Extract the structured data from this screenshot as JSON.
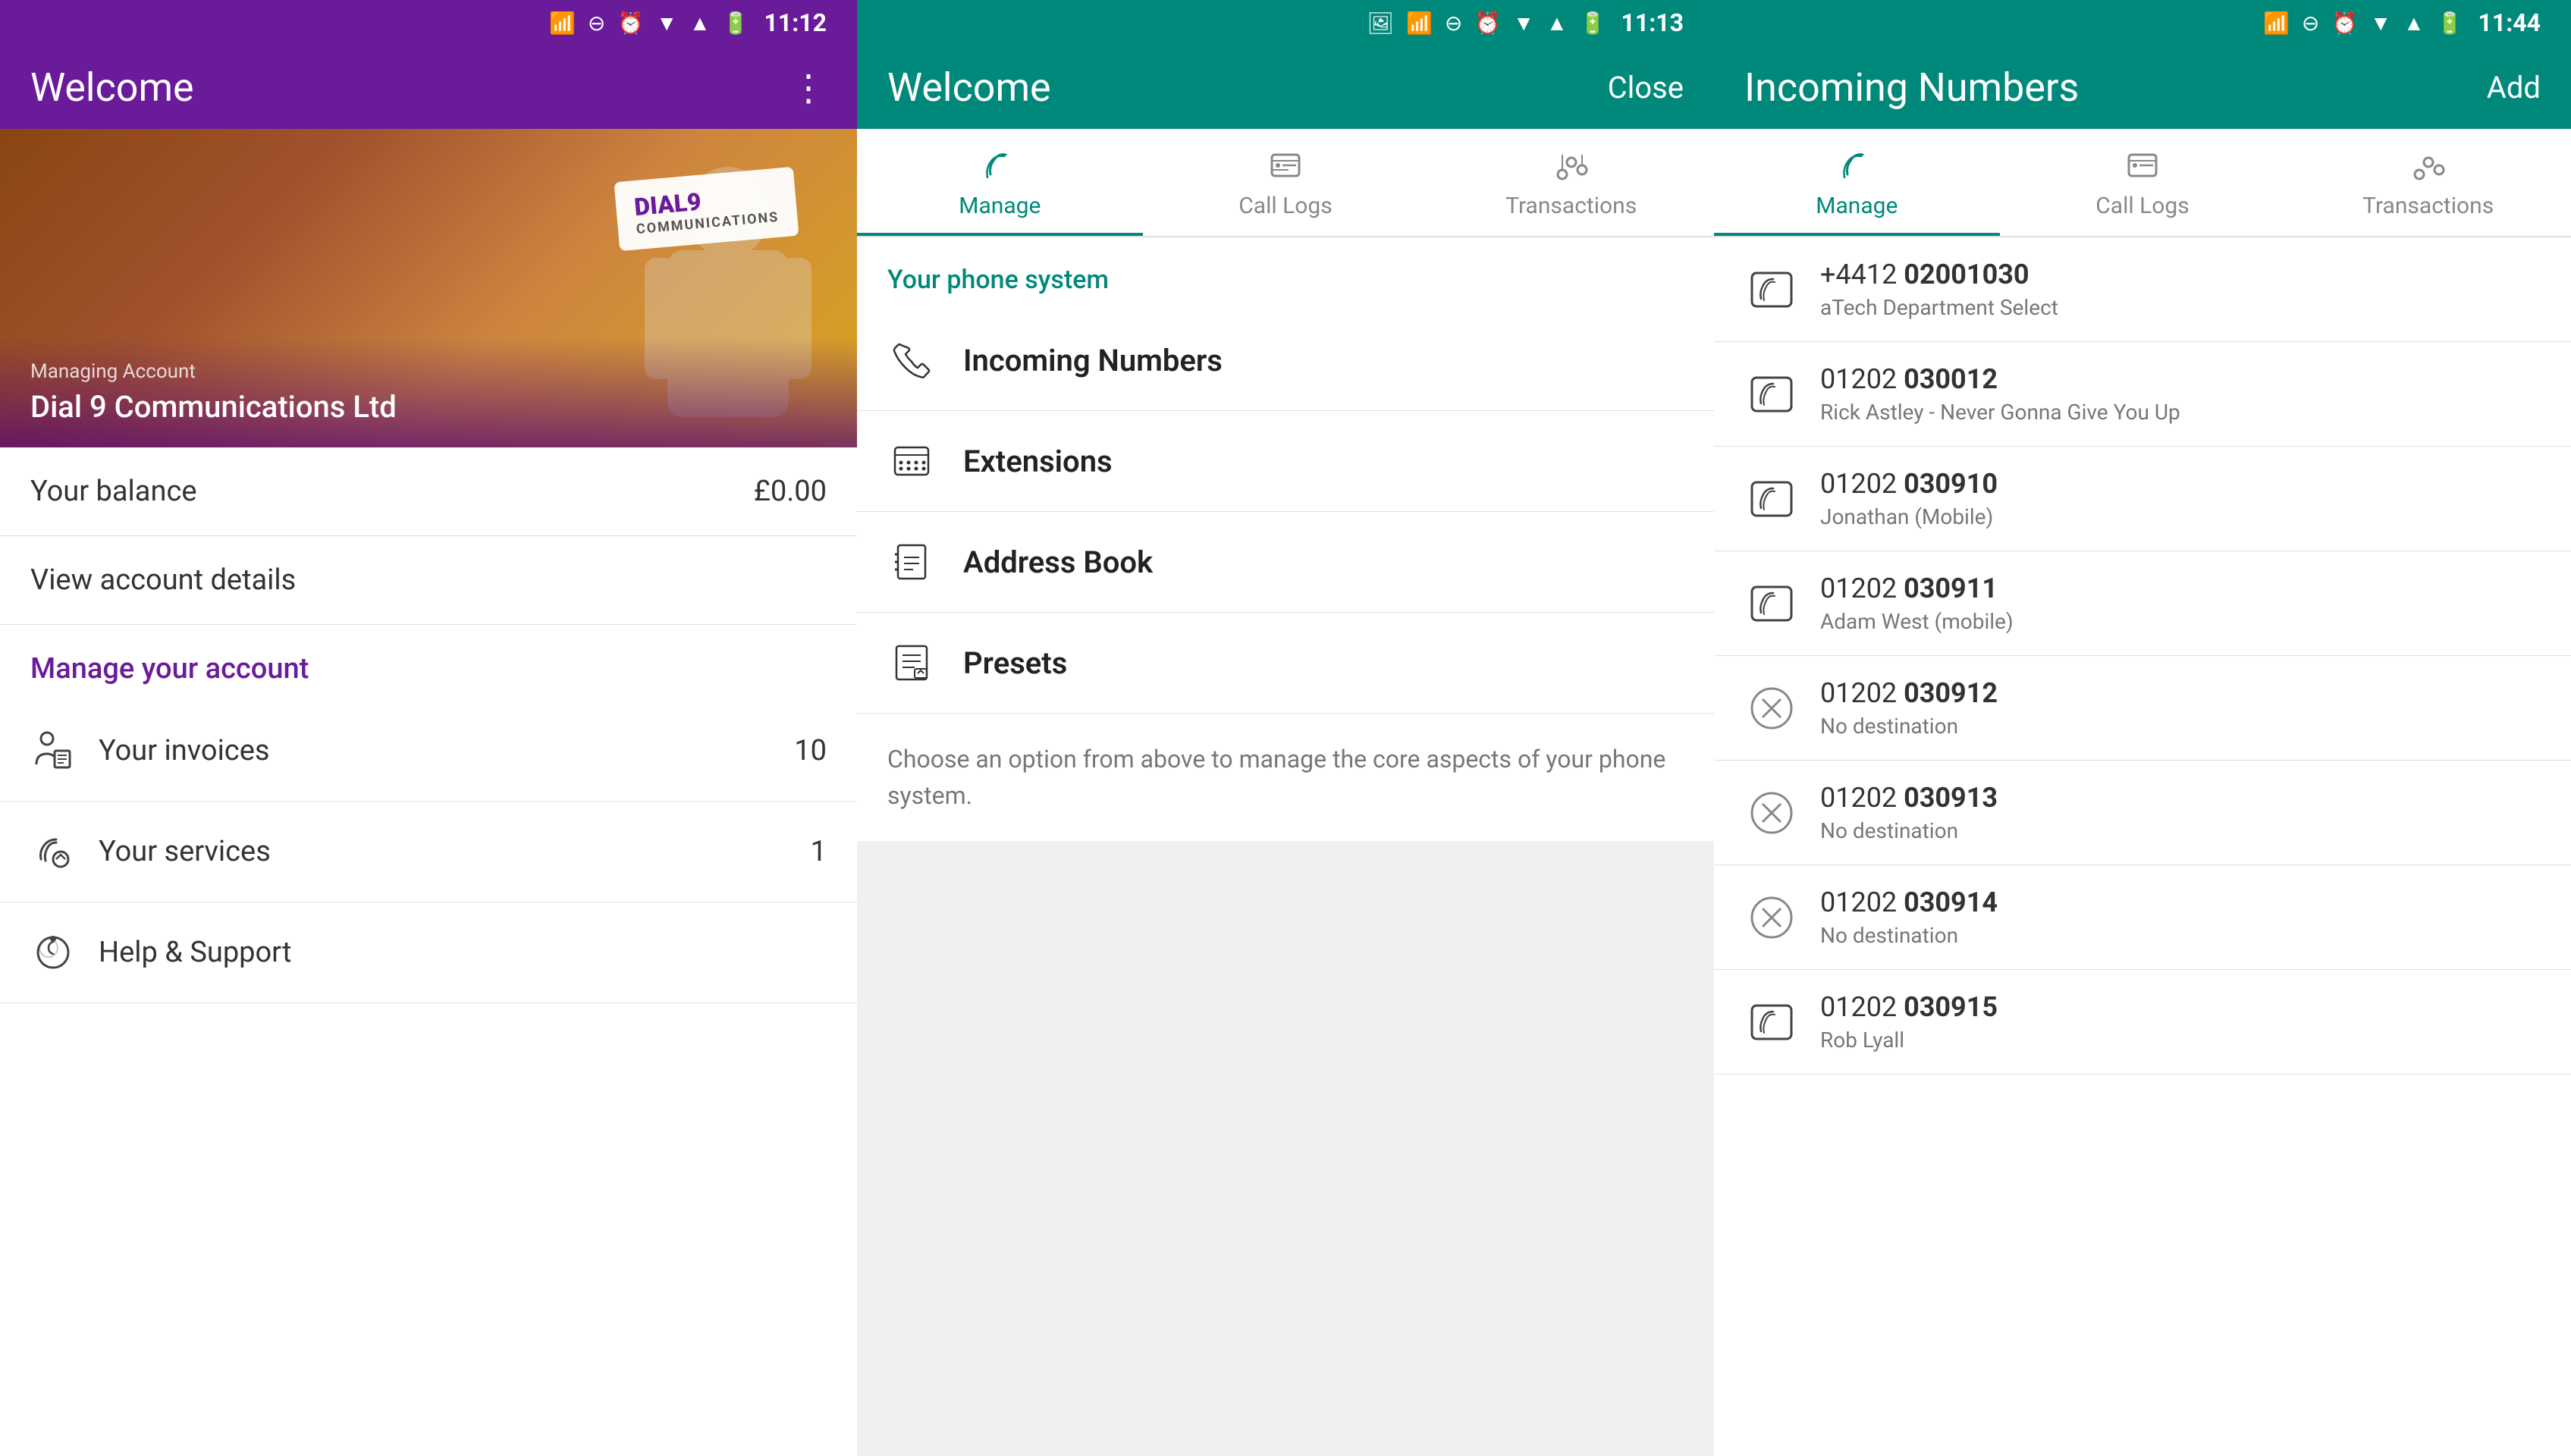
{
  "screen1": {
    "statusBar": {
      "time": "11:12"
    },
    "header": {
      "title": "Welcome"
    },
    "hero": {
      "managing": "Managing Account",
      "company": "Dial 9 Communications Ltd",
      "logo": "DIAL9\nCOMMUNICATIONS"
    },
    "balance": {
      "label": "Your balance",
      "amount": "£0.00"
    },
    "viewAccount": "View account details",
    "manageSection": "Manage your account",
    "invoices": {
      "label": "Your invoices",
      "count": "10"
    },
    "services": {
      "label": "Your services",
      "count": "1"
    },
    "helpSupport": "Help & Support"
  },
  "screen2": {
    "statusBar": {
      "time": "11:13"
    },
    "header": {
      "title": "Welcome",
      "closeBtn": "Close"
    },
    "tabs": [
      {
        "label": "Manage",
        "active": true
      },
      {
        "label": "Call Logs",
        "active": false
      },
      {
        "label": "Transactions",
        "active": false
      }
    ],
    "phoneSystem": {
      "sectionLabel": "Your phone system",
      "items": [
        {
          "label": "Incoming Numbers"
        },
        {
          "label": "Extensions"
        },
        {
          "label": "Address Book"
        },
        {
          "label": "Presets"
        }
      ]
    },
    "hintText": "Choose an option from above to manage the core aspects of your phone system."
  },
  "screen3": {
    "statusBar": {
      "time": "11:44"
    },
    "header": {
      "title": "Incoming Numbers",
      "addBtn": "Add"
    },
    "tabs": [
      {
        "label": "Manage",
        "active": true
      },
      {
        "label": "Call Logs",
        "active": false
      },
      {
        "label": "Transactions",
        "active": false
      }
    ],
    "numbers": [
      {
        "prefix": "+4412",
        "number": "02001030",
        "name": "aTech Department Select",
        "iconType": "phone-box"
      },
      {
        "prefix": "01202",
        "number": "030012",
        "name": "Rick Astley - Never Gonna Give You Up",
        "iconType": "phone-box"
      },
      {
        "prefix": "01202",
        "number": "030910",
        "name": "Jonathan (Mobile)",
        "iconType": "phone-box"
      },
      {
        "prefix": "01202",
        "number": "030911",
        "name": "Adam West (mobile)",
        "iconType": "phone-box"
      },
      {
        "prefix": "01202",
        "number": "030912",
        "name": "No destination",
        "iconType": "x-circle"
      },
      {
        "prefix": "01202",
        "number": "030913",
        "name": "No destination",
        "iconType": "x-circle"
      },
      {
        "prefix": "01202",
        "number": "030914",
        "name": "No destination",
        "iconType": "x-circle"
      },
      {
        "prefix": "01202",
        "number": "030915",
        "name": "Rob Lyall",
        "iconType": "phone-box"
      }
    ]
  }
}
